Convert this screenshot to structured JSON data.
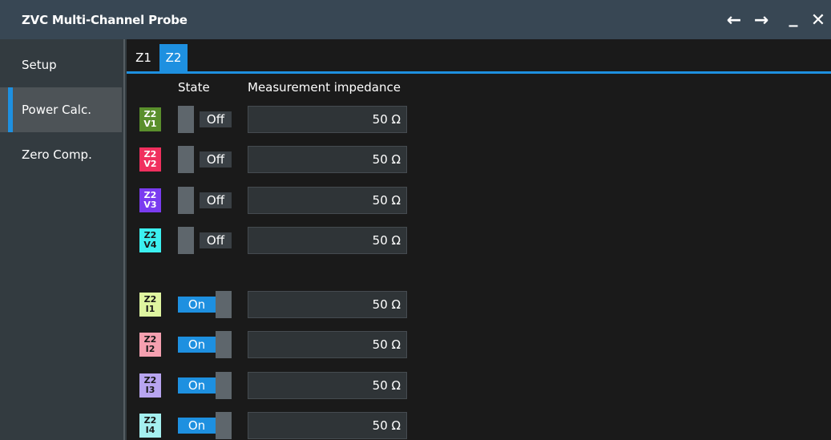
{
  "window": {
    "title": "ZVC Multi-Channel Probe",
    "buttons": {
      "back": "←",
      "forward": "→",
      "minimize": "_",
      "close": "✕"
    }
  },
  "sidebar": {
    "items": [
      {
        "label": "Setup",
        "active": false
      },
      {
        "label": "Power Calc.",
        "active": true
      },
      {
        "label": "Zero Comp.",
        "active": false
      }
    ]
  },
  "tabs": [
    {
      "label": "Z1",
      "active": false
    },
    {
      "label": "Z2",
      "active": true
    }
  ],
  "headers": {
    "state": "State",
    "impedance": "Measurement impedance"
  },
  "channels": [
    {
      "line1": "Z2",
      "line2": "V1",
      "color": "#5a8f2c",
      "text_color": "#ffffff",
      "state": "Off",
      "impedance": "50 Ω"
    },
    {
      "line1": "Z2",
      "line2": "V2",
      "color": "#f0305e",
      "text_color": "#ffffff",
      "state": "Off",
      "impedance": "50 Ω"
    },
    {
      "line1": "Z2",
      "line2": "V3",
      "color": "#7a3cf0",
      "text_color": "#ffffff",
      "state": "Off",
      "impedance": "50 Ω"
    },
    {
      "line1": "Z2",
      "line2": "V4",
      "color": "#3cf0f0",
      "text_color": "#1a1a1a",
      "state": "Off",
      "impedance": "50 Ω"
    },
    {
      "line1": "Z2",
      "line2": "I1",
      "color": "#dff5a0",
      "text_color": "#1a1a1a",
      "state": "On",
      "impedance": "50 Ω"
    },
    {
      "line1": "Z2",
      "line2": "I2",
      "color": "#f5a0b0",
      "text_color": "#1a1a1a",
      "state": "On",
      "impedance": "50 Ω"
    },
    {
      "line1": "Z2",
      "line2": "I3",
      "color": "#b8a5f0",
      "text_color": "#1a1a1a",
      "state": "On",
      "impedance": "50 Ω"
    },
    {
      "line1": "Z2",
      "line2": "I4",
      "color": "#a5f0f0",
      "text_color": "#1a1a1a",
      "state": "On",
      "impedance": "50 Ω"
    }
  ],
  "colors": {
    "accent": "#1e90e0",
    "titlebar": "#384754",
    "sidebar": "#333b40"
  }
}
